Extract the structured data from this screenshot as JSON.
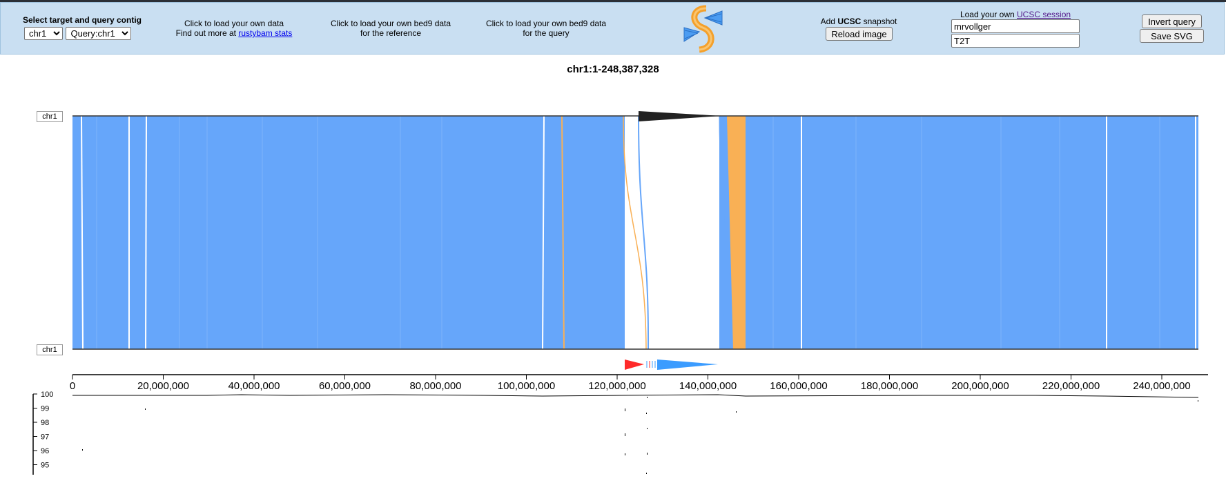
{
  "header": {
    "select_title": "Select target and query contig",
    "target_select": {
      "value": "chr1",
      "options": [
        "chr1"
      ]
    },
    "query_select": {
      "value": "Query:chr1",
      "options": [
        "Query:chr1"
      ]
    },
    "load_data_line1": "Click to load your own data",
    "load_data_line2": "Find out more at",
    "rustybam_link": "rustybam stats",
    "bed9_ref_line1": "Click to load your own bed9 data",
    "bed9_ref_line2": "for the reference",
    "bed9_query_line1": "Click to load your own bed9 data",
    "bed9_query_line2": "for the query",
    "add_label_prefix": "Add",
    "add_label_bold": "UCSC",
    "add_label_suffix": "snapshot",
    "reload_button": "Reload image",
    "session_label_prefix": "Load your own",
    "session_link": "UCSC session",
    "session_user_value": "mrvollger",
    "session_name_value": "T2T",
    "invert_button": "Invert query",
    "save_svg_button": "Save SVG"
  },
  "plot": {
    "title": "chr1:1-248,387,328",
    "target_label": "chr1",
    "query_label": "chr1",
    "colors": {
      "forward": "#66a6fa",
      "inverted": "#f9b055",
      "gap": "#ffffff",
      "arrow_red": "#ff2a2a",
      "arrow_blue": "#3b9cff"
    },
    "axis_ticks": [
      "0",
      "20,000,000",
      "40,000,000",
      "60,000,000",
      "80,000,000",
      "100,000,000",
      "120,000,000",
      "140,000,000",
      "160,000,000",
      "180,000,000",
      "200,000,000",
      "220,000,000",
      "240,000,000"
    ],
    "identity_ticks": [
      "100",
      "99",
      "98",
      "97",
      "96",
      "95"
    ]
  }
}
